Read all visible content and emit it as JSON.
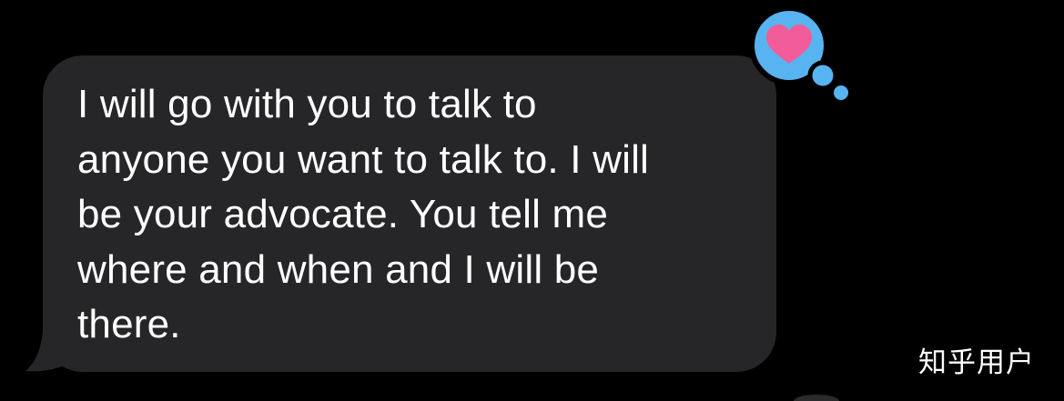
{
  "message": {
    "text": "I will go with you to talk to\nanyone you want to talk to. I will\nbe your advocate. You tell me\nwhere and when and I will be\nthere."
  },
  "reaction": {
    "icon": "heart-icon",
    "badge_color": "#58B4F0",
    "heart_color": "#F25C9A"
  },
  "watermark": {
    "text": "知乎用户"
  },
  "colors": {
    "background": "#000000",
    "bubble": "#262628",
    "text": "#FFFFFF"
  }
}
